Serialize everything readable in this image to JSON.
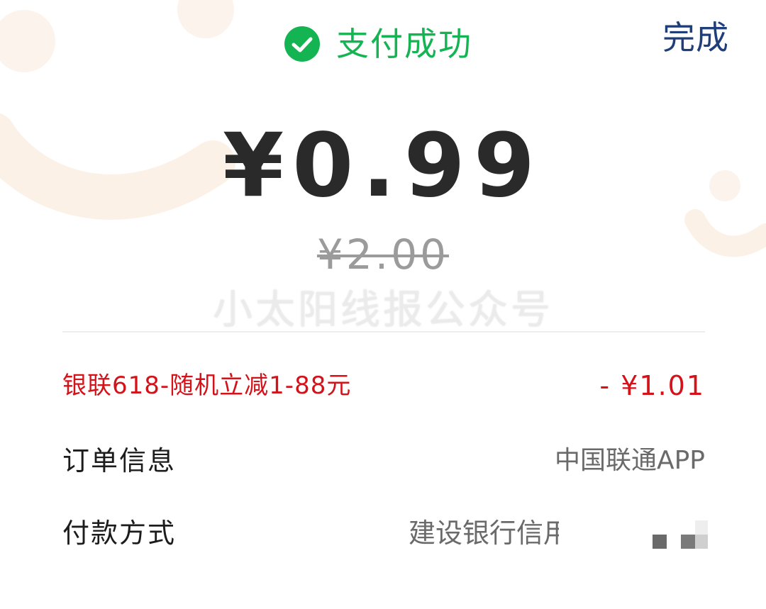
{
  "header": {
    "status_title": "支付成功",
    "done_label": "完成",
    "status_color": "#15b453",
    "done_color": "#1f3f7b"
  },
  "payment": {
    "amount": "¥0.99",
    "original_amount": "¥2.00"
  },
  "watermark": "小太阳线报公众号",
  "details": {
    "discount": {
      "label": "银联618-随机立减1-88元",
      "value": "- ¥1.01",
      "color": "#d4121a"
    },
    "order": {
      "label": "订单信息",
      "value": "中国联通APP"
    },
    "payment_method": {
      "label": "付款方式",
      "value": "建设银行信用"
    }
  },
  "icons": {
    "status": "check-circle-icon"
  }
}
